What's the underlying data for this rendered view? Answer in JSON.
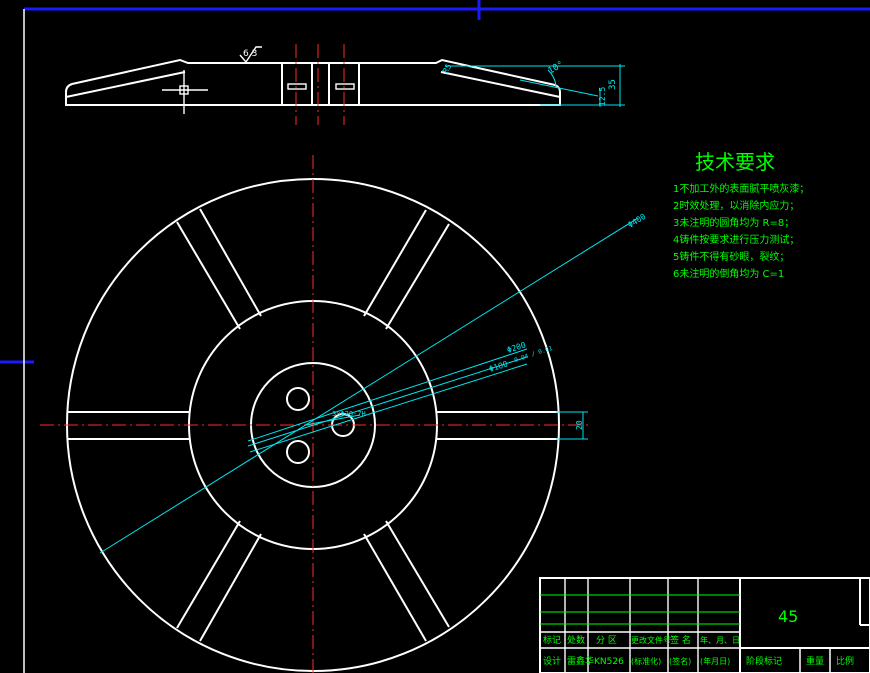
{
  "drawing": {
    "tech_title": "技术要求",
    "tech_notes": [
      "1不加工外的表面腻平喷灰漆；",
      "2时效处理，以消除内应力；",
      "3未注明的圆角均为 R=8；",
      "4铸件按要求进行压力测试；",
      "5铸件不得有砂眼，裂纹；",
      "6未注明的倒角均为 C=1"
    ],
    "dims": {
      "roughness": "6.3",
      "angle": "10°",
      "r_small": "R5",
      "height": "35",
      "h_small": "12.5",
      "dia_outer": "Φ400",
      "dia_mid": "Φ200",
      "dia_hub": "Φ100",
      "hub_tol": "0.04 / 0.01",
      "holes": "3×Φ20-7H",
      "slot_w": "20"
    },
    "title_block": {
      "material": "45",
      "row_labels_1": [
        "标记",
        "处数",
        "分 区",
        "更改文件号",
        "签 名",
        "年、月、日"
      ],
      "row_labels_2": [
        "设计",
        "雷鑫华",
        "KN526",
        "(标准化)",
        "(签名)",
        "(年月日)"
      ],
      "right_labels": [
        "阶段标记",
        "重量",
        "比例"
      ]
    }
  }
}
